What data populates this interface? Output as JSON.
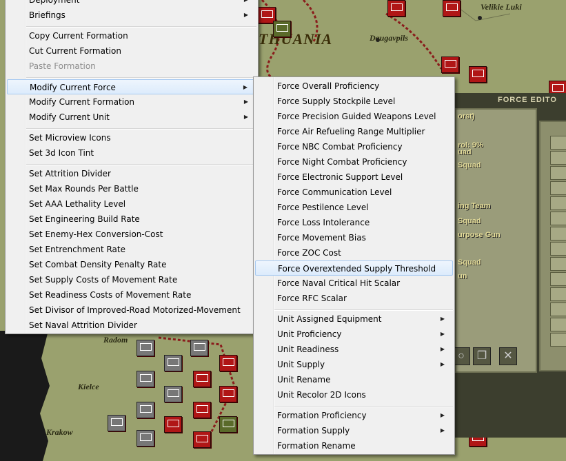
{
  "map": {
    "labels": {
      "lithuania": "THUANIA",
      "daugavpils": "Daugavpils",
      "velikie_luki": "Velikie Luki",
      "radom": "Radom",
      "kielce": "Kielce",
      "krakow": "Krakow"
    }
  },
  "force_editor": {
    "title": "FORCE EDITO",
    "lines": [
      "orst)",
      "rol: 9%",
      "uad",
      "Squad",
      "ing Team",
      "Squad",
      "urpose Gun",
      "Squad",
      "un"
    ]
  },
  "main_menu": {
    "items": [
      {
        "label": "Deployment",
        "submenu": true
      },
      {
        "label": "Briefings",
        "submenu": true
      },
      {
        "separator": true
      },
      {
        "label": "Copy Current Formation"
      },
      {
        "label": "Cut Current Formation"
      },
      {
        "label": "Paste Formation",
        "disabled": true
      },
      {
        "separator": true
      },
      {
        "label": "Modify Current Force",
        "submenu": true,
        "highlight": true
      },
      {
        "label": "Modify Current Formation",
        "submenu": true
      },
      {
        "label": "Modify Current Unit",
        "submenu": true
      },
      {
        "separator": true
      },
      {
        "label": "Set Microview Icons"
      },
      {
        "label": "Set 3d Icon Tint"
      },
      {
        "separator": true
      },
      {
        "label": "Set Attrition Divider"
      },
      {
        "label": "Set Max Rounds Per Battle"
      },
      {
        "label": "Set AAA Lethality Level"
      },
      {
        "label": "Set Engineering Build Rate"
      },
      {
        "label": "Set Enemy-Hex Conversion-Cost"
      },
      {
        "label": "Set Entrenchment Rate"
      },
      {
        "label": "Set Combat Density Penalty Rate"
      },
      {
        "label": "Set Supply Costs of Movement Rate"
      },
      {
        "label": "Set Readiness Costs of Movement Rate"
      },
      {
        "label": "Set Divisor of Improved-Road Motorized-Movement"
      },
      {
        "label": "Set Naval Attrition Divider"
      }
    ]
  },
  "sub_menu": {
    "items": [
      {
        "label": "Force Overall Proficiency"
      },
      {
        "label": "Force Supply Stockpile Level"
      },
      {
        "label": "Force Precision Guided Weapons Level"
      },
      {
        "label": "Force Air Refueling Range Multiplier"
      },
      {
        "label": "Force NBC Combat Proficiency"
      },
      {
        "label": "Force Night Combat Proficiency"
      },
      {
        "label": "Force Electronic Support Level"
      },
      {
        "label": "Force Communication Level"
      },
      {
        "label": "Force Pestilence Level"
      },
      {
        "label": "Force Loss Intolerance"
      },
      {
        "label": "Force Movement Bias"
      },
      {
        "label": "Force ZOC Cost"
      },
      {
        "label": "Force Overextended Supply Threshold",
        "highlight": true
      },
      {
        "label": "Force Naval Critical Hit Scalar"
      },
      {
        "label": "Force RFC Scalar"
      },
      {
        "separator": true
      },
      {
        "label": "Unit Assigned Equipment",
        "submenu": true
      },
      {
        "label": "Unit Proficiency",
        "submenu": true
      },
      {
        "label": "Unit Readiness",
        "submenu": true
      },
      {
        "label": "Unit Supply",
        "submenu": true
      },
      {
        "label": "Unit Rename"
      },
      {
        "label": "Unit Recolor 2D Icons"
      },
      {
        "separator": true
      },
      {
        "label": "Formation Proficiency",
        "submenu": true
      },
      {
        "label": "Formation Supply",
        "submenu": true
      },
      {
        "label": "Formation Rename"
      }
    ]
  },
  "colors": {
    "menu_bg": "#f0f0f0",
    "highlight_border": "#a6c9f1",
    "unit_red": "#b01616",
    "map_green": "#9aa16e"
  },
  "icons": {
    "submenu_arrow": "submenu-arrow-icon"
  }
}
